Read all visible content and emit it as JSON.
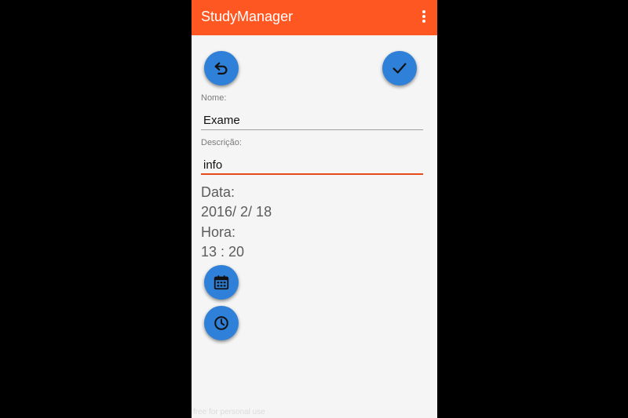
{
  "app": {
    "title": "StudyManager",
    "accent_color": "#ff5722",
    "fab_color": "#2f80d8"
  },
  "toolbar": {
    "overflow_icon": "more-vert-icon",
    "back_icon": "undo-arrow-icon",
    "confirm_icon": "check-icon"
  },
  "form": {
    "nome_label": "Nome:",
    "nome_value": "Exame",
    "descricao_label": "Descrição:",
    "descricao_value": "info",
    "data_label": "Data:",
    "data_value": "2016/ 2/ 18",
    "hora_label": "Hora:",
    "hora_value": "13 : 20"
  },
  "actions": {
    "calendar_icon": "calendar-icon",
    "clock_icon": "clock-icon"
  },
  "footer": {
    "watermark": "free for personal use"
  }
}
